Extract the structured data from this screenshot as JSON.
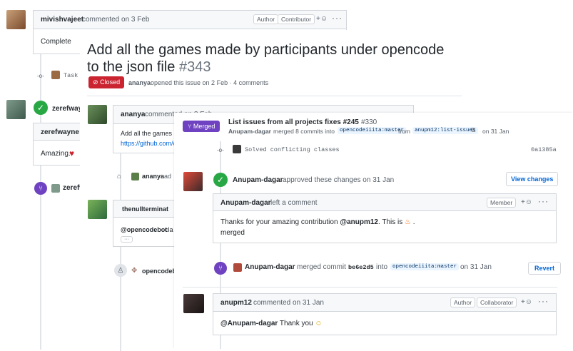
{
  "layer1": {
    "comment1": {
      "author": "mivishvajeet",
      "meta": "commented on 3 Feb",
      "badges": [
        "Author",
        "Contributor"
      ],
      "body": "Complete"
    },
    "task_label": "Task C",
    "review1": {
      "author": "zerefwayne",
      "approved_partial": "zerefwayn"
    },
    "comment2": {
      "author": "zerefwayne",
      "meta": "le",
      "body": "Amazing."
    },
    "merged_partial": "zerefw"
  },
  "layer2": {
    "title": "Add all the games made by participants under opencode to the json file",
    "number": "#343",
    "state_label": "Closed",
    "opened_author": "ananya",
    "opened_meta": "opened this issue on 2 Feb · 4 comments",
    "comment": {
      "author": "ananya",
      "meta": "commented on 3 Feb",
      "body_line1": "Add all the games m",
      "body_link": "https://github.com/o"
    },
    "label_event": {
      "author": "ananya",
      "meta": "ad"
    },
    "bot_comment": {
      "author": "thenullterminat",
      "body_bot": "@opencodebot",
      "body_rest": " cla",
      "ellipsis": "···"
    },
    "last_event": {
      "author": "opencodeb"
    }
  },
  "layer3": {
    "header": {
      "state_label": "Merged",
      "title": "List issues from all projects fixes #245",
      "number": "#330",
      "merge_author": "Anupam-dagar",
      "merge_text": "merged 8 commits into",
      "base": "opencodeiiita:master",
      "from": "from",
      "head": "anupm12:list-issues",
      "date": "on 31 Jan"
    },
    "commit": {
      "message": "Solved conflicting classes",
      "sha": "0a1385a"
    },
    "review": {
      "author": "Anupam-dagar",
      "meta": "approved these changes on 31 Jan",
      "button": "View changes"
    },
    "review_comment": {
      "author": "Anupam-dagar",
      "meta": "left a comment",
      "badge": "Member",
      "body_pre": "Thanks for your amazing contribution ",
      "body_mention": "@anupm12",
      "body_post": ". This is",
      "line2": "merged"
    },
    "merge_event": {
      "author": "Anupam-dagar",
      "text": "merged commit",
      "sha": "be6e2d5",
      "into": "into",
      "base": "opencodeiiita:master",
      "date": "on 31 Jan",
      "button": "Revert"
    },
    "final_comment": {
      "author": "anupm12",
      "meta": "commented on 31 Jan",
      "badges": [
        "Author",
        "Collaborator"
      ],
      "mention": "@Anupam-dagar",
      "body": " Thank you"
    }
  },
  "colors": {
    "closed": "#cb2431",
    "merged": "#6f42c1",
    "approved": "#28a745",
    "link": "#0366d6"
  }
}
